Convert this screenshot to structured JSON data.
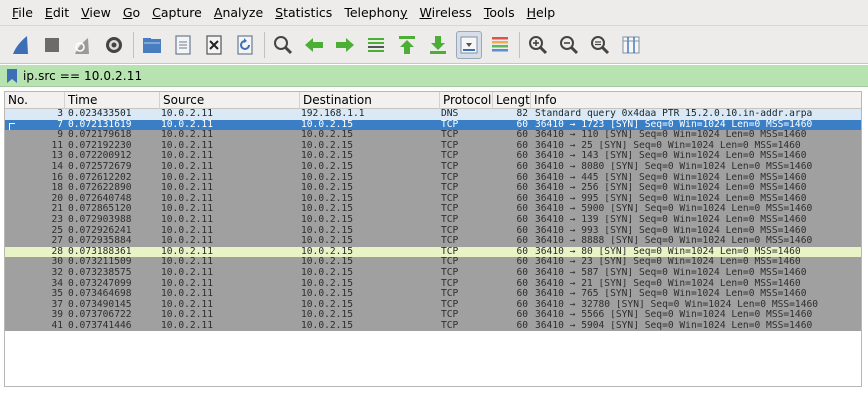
{
  "menubar": {
    "items": [
      {
        "label": "File",
        "acc": "F",
        "rest": "ile"
      },
      {
        "label": "Edit",
        "acc": "E",
        "rest": "dit"
      },
      {
        "label": "View",
        "acc": "V",
        "rest": "iew"
      },
      {
        "label": "Go",
        "acc": "G",
        "rest": "o"
      },
      {
        "label": "Capture",
        "acc": "C",
        "rest": "apture"
      },
      {
        "label": "Analyze",
        "acc": "A",
        "rest": "nalyze"
      },
      {
        "label": "Statistics",
        "acc": "S",
        "rest": "tatistics"
      },
      {
        "label": "Telephony",
        "pre": "Telephon",
        "acc": "y",
        "rest": ""
      },
      {
        "label": "Wireless",
        "acc": "W",
        "rest": "ireless"
      },
      {
        "label": "Tools",
        "acc": "T",
        "rest": "ools"
      },
      {
        "label": "Help",
        "acc": "H",
        "rest": "elp"
      }
    ]
  },
  "toolbar": {
    "icons": [
      "shark-fin-icon",
      "stop-square-icon",
      "restart-fin-icon",
      "gear-options-icon",
      "folder-open-icon",
      "file-document-icon",
      "close-file-icon",
      "reload-icon",
      "find-magnifier-icon",
      "go-back-arrow-icon",
      "go-forward-arrow-icon",
      "go-to-packet-icon",
      "go-first-icon",
      "go-last-icon",
      "autoscroll-icon",
      "colorize-icon",
      "zoom-in-icon",
      "zoom-out-icon",
      "zoom-normal-icon",
      "resize-columns-icon"
    ],
    "colors": {
      "blue": "#3d6fb6",
      "green": "#4caf35",
      "gray": "#6b6b6b"
    }
  },
  "filter": {
    "text": "ip.src == 10.0.2.11",
    "background": "#b7e3b0"
  },
  "columns": {
    "no": "No.",
    "time": "Time",
    "source": "Source",
    "destination": "Destination",
    "protocol": "Protocol",
    "length": "Length",
    "info": "Info"
  },
  "colors": {
    "dns_row": "#dbe9f7",
    "selected_row": "#3a7fc6",
    "tcp_row": "#a0a0a0",
    "highlight_row": "#e9f4c6"
  },
  "packets": [
    {
      "no": "3",
      "time": "0.023433501",
      "src": "10.0.2.11",
      "dst": "192.168.1.1",
      "proto": "DNS",
      "len": "82",
      "info": "Standard query 0x4daa PTR 15.2.0.10.in-addr.arpa",
      "style": "dns"
    },
    {
      "no": "7",
      "time": "0.072131619",
      "src": "10.0.2.11",
      "dst": "10.0.2.15",
      "proto": "TCP",
      "len": "60",
      "info": "36410 → 1723 [SYN] Seq=0 Win=1024 Len=0 MSS=1460",
      "style": "sel"
    },
    {
      "no": "9",
      "time": "0.072179618",
      "src": "10.0.2.11",
      "dst": "10.0.2.15",
      "proto": "TCP",
      "len": "60",
      "info": "36410 → 110 [SYN] Seq=0 Win=1024 Len=0 MSS=1460",
      "style": "tcp"
    },
    {
      "no": "11",
      "time": "0.072192230",
      "src": "10.0.2.11",
      "dst": "10.0.2.15",
      "proto": "TCP",
      "len": "60",
      "info": "36410 → 25 [SYN] Seq=0 Win=1024 Len=0 MSS=1460",
      "style": "tcp"
    },
    {
      "no": "13",
      "time": "0.072200912",
      "src": "10.0.2.11",
      "dst": "10.0.2.15",
      "proto": "TCP",
      "len": "60",
      "info": "36410 → 143 [SYN] Seq=0 Win=1024 Len=0 MSS=1460",
      "style": "tcp"
    },
    {
      "no": "14",
      "time": "0.072572679",
      "src": "10.0.2.11",
      "dst": "10.0.2.15",
      "proto": "TCP",
      "len": "60",
      "info": "36410 → 8080 [SYN] Seq=0 Win=1024 Len=0 MSS=1460",
      "style": "tcp"
    },
    {
      "no": "16",
      "time": "0.072612202",
      "src": "10.0.2.11",
      "dst": "10.0.2.15",
      "proto": "TCP",
      "len": "60",
      "info": "36410 → 445 [SYN] Seq=0 Win=1024 Len=0 MSS=1460",
      "style": "tcp"
    },
    {
      "no": "18",
      "time": "0.072622890",
      "src": "10.0.2.11",
      "dst": "10.0.2.15",
      "proto": "TCP",
      "len": "60",
      "info": "36410 → 256 [SYN] Seq=0 Win=1024 Len=0 MSS=1460",
      "style": "tcp"
    },
    {
      "no": "20",
      "time": "0.072640748",
      "src": "10.0.2.11",
      "dst": "10.0.2.15",
      "proto": "TCP",
      "len": "60",
      "info": "36410 → 995 [SYN] Seq=0 Win=1024 Len=0 MSS=1460",
      "style": "tcp"
    },
    {
      "no": "21",
      "time": "0.072865120",
      "src": "10.0.2.11",
      "dst": "10.0.2.15",
      "proto": "TCP",
      "len": "60",
      "info": "36410 → 5900 [SYN] Seq=0 Win=1024 Len=0 MSS=1460",
      "style": "tcp"
    },
    {
      "no": "23",
      "time": "0.072903988",
      "src": "10.0.2.11",
      "dst": "10.0.2.15",
      "proto": "TCP",
      "len": "60",
      "info": "36410 → 139 [SYN] Seq=0 Win=1024 Len=0 MSS=1460",
      "style": "tcp"
    },
    {
      "no": "25",
      "time": "0.072926241",
      "src": "10.0.2.11",
      "dst": "10.0.2.15",
      "proto": "TCP",
      "len": "60",
      "info": "36410 → 993 [SYN] Seq=0 Win=1024 Len=0 MSS=1460",
      "style": "tcp"
    },
    {
      "no": "27",
      "time": "0.072935884",
      "src": "10.0.2.11",
      "dst": "10.0.2.15",
      "proto": "TCP",
      "len": "60",
      "info": "36410 → 8888 [SYN] Seq=0 Win=1024 Len=0 MSS=1460",
      "style": "tcp"
    },
    {
      "no": "28",
      "time": "0.073188361",
      "src": "10.0.2.11",
      "dst": "10.0.2.15",
      "proto": "TCP",
      "len": "60",
      "info": "36410 → 80 [SYN] Seq=0 Win=1024 Len=0 MSS=1460",
      "style": "hl"
    },
    {
      "no": "30",
      "time": "0.073211509",
      "src": "10.0.2.11",
      "dst": "10.0.2.15",
      "proto": "TCP",
      "len": "60",
      "info": "36410 → 23 [SYN] Seq=0 Win=1024 Len=0 MSS=1460",
      "style": "tcp"
    },
    {
      "no": "32",
      "time": "0.073238575",
      "src": "10.0.2.11",
      "dst": "10.0.2.15",
      "proto": "TCP",
      "len": "60",
      "info": "36410 → 587 [SYN] Seq=0 Win=1024 Len=0 MSS=1460",
      "style": "tcp"
    },
    {
      "no": "34",
      "time": "0.073247099",
      "src": "10.0.2.11",
      "dst": "10.0.2.15",
      "proto": "TCP",
      "len": "60",
      "info": "36410 → 21 [SYN] Seq=0 Win=1024 Len=0 MSS=1460",
      "style": "tcp"
    },
    {
      "no": "35",
      "time": "0.073464698",
      "src": "10.0.2.11",
      "dst": "10.0.2.15",
      "proto": "TCP",
      "len": "60",
      "info": "36410 → 765 [SYN] Seq=0 Win=1024 Len=0 MSS=1460",
      "style": "tcp"
    },
    {
      "no": "37",
      "time": "0.073490145",
      "src": "10.0.2.11",
      "dst": "10.0.2.15",
      "proto": "TCP",
      "len": "60",
      "info": "36410 → 32780 [SYN] Seq=0 Win=1024 Len=0 MSS=1460",
      "style": "tcp"
    },
    {
      "no": "39",
      "time": "0.073706722",
      "src": "10.0.2.11",
      "dst": "10.0.2.15",
      "proto": "TCP",
      "len": "60",
      "info": "36410 → 5566 [SYN] Seq=0 Win=1024 Len=0 MSS=1460",
      "style": "tcp"
    },
    {
      "no": "41",
      "time": "0.073741446",
      "src": "10.0.2.11",
      "dst": "10.0.2.15",
      "proto": "TCP",
      "len": "60",
      "info": "36410 → 5904 [SYN] Seq=0 Win=1024 Len=0 MSS=1460",
      "style": "tcp"
    }
  ]
}
